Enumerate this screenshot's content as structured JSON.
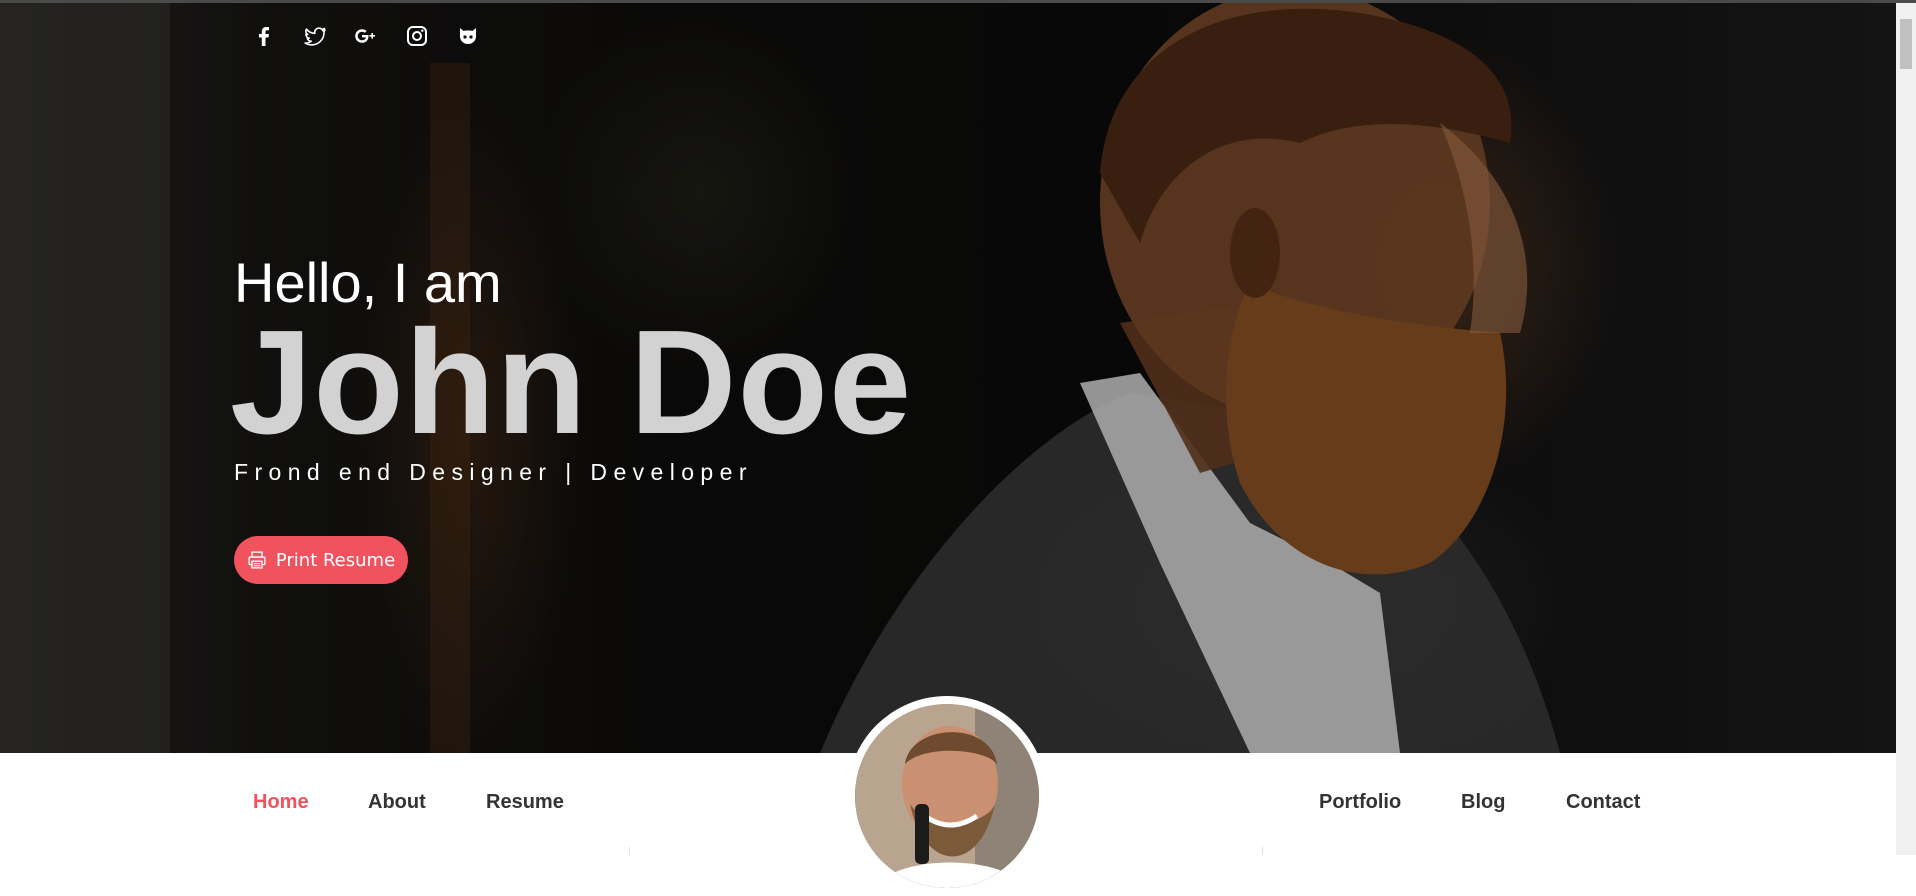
{
  "hero": {
    "greeting": "Hello, I am",
    "name": "John Doe",
    "role": "Frond end Designer | Developer",
    "print_button_label": "Print Resume"
  },
  "social": [
    {
      "icon": "facebook-icon"
    },
    {
      "icon": "twitter-icon"
    },
    {
      "icon": "google-plus-icon"
    },
    {
      "icon": "instagram-icon"
    },
    {
      "icon": "github-icon"
    }
  ],
  "nav": {
    "left": [
      "Home",
      "About",
      "Resume"
    ],
    "right": [
      "Portfolio",
      "Blog",
      "Contact"
    ],
    "active": "Home"
  },
  "colors": {
    "accent": "#f0525e",
    "nav_text": "#333333",
    "name_text": "#d2d2d2"
  }
}
